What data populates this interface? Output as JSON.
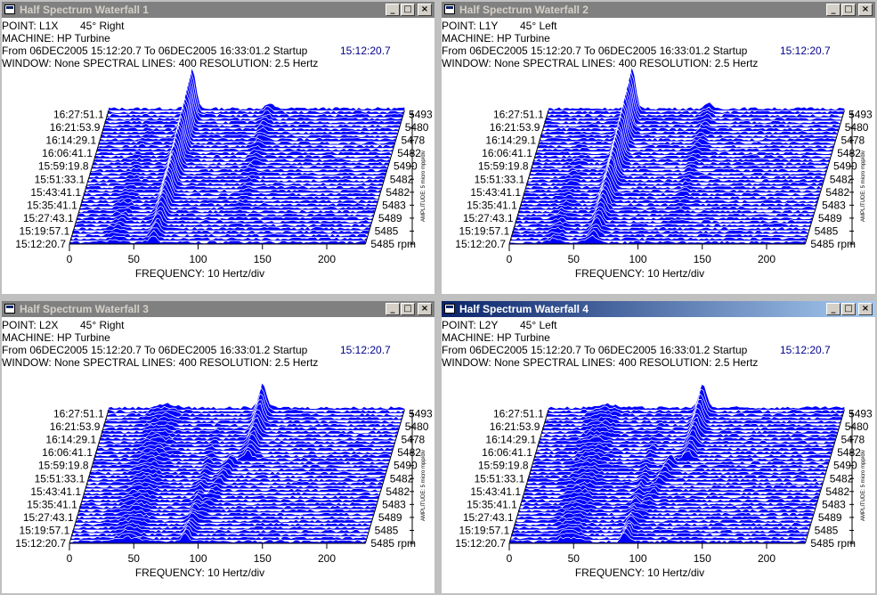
{
  "windows": [
    {
      "title": "Half Spectrum Waterfall 1",
      "active": false,
      "point": "POINT: L1X",
      "angle": "45° Right",
      "machine": "MACHINE: HP Turbine",
      "range": "From 06DEC2005 15:12:20.7 To 06DEC2005 16:33:01.2 Startup",
      "time": "15:12:20.7",
      "window_line": "WINDOW: None SPECTRAL LINES: 400 RESOLUTION: 2.5 Hertz",
      "peak_freq": 65,
      "peak_trend": "front-to-back"
    },
    {
      "title": "Half Spectrum Waterfall 2",
      "active": false,
      "point": "POINT: L1Y",
      "angle": "45° Left",
      "machine": "MACHINE: HP Turbine",
      "range": "From 06DEC2005 15:12:20.7 To 06DEC2005 16:33:01.2 Startup",
      "time": "15:12:20.7",
      "window_line": "WINDOW: None SPECTRAL LINES: 400 RESOLUTION: 2.5 Hertz",
      "peak_freq": 65,
      "peak_trend": "front-to-back"
    },
    {
      "title": "Half Spectrum Waterfall 3",
      "active": false,
      "point": "POINT: L2X",
      "angle": "45° Right",
      "machine": "MACHINE: HP Turbine",
      "range": "From 06DEC2005 15:12:20.7 To 06DEC2005 16:33:01.2 Startup",
      "time": "15:12:20.7",
      "window_line": "WINDOW: None SPECTRAL LINES: 400 RESOLUTION: 2.5 Hertz",
      "peak_freq": 90,
      "peak_trend": "back"
    },
    {
      "title": "Half Spectrum Waterfall 4",
      "active": true,
      "point": "POINT: L2Y",
      "angle": "45° Left",
      "machine": "MACHINE: HP Turbine",
      "range": "From 06DEC2005 15:12:20.7 To 06DEC2005 16:33:01.2 Startup",
      "time": "15:12:20.7",
      "window_line": "WINDOW: None SPECTRAL LINES: 400 RESOLUTION: 2.5 Hertz",
      "peak_freq": 90,
      "peak_trend": "back"
    }
  ],
  "chart_data": {
    "type": "waterfall",
    "xlabel": "FREQUENCY: 10 Hertz/div",
    "x_ticks": [
      "0",
      "50",
      "100",
      "150",
      "200"
    ],
    "xlim": [
      0,
      200
    ],
    "ylabel": "AMPLITUDE: 5 micro mpp/div",
    "time_labels": [
      "16:27:51.1",
      "16:21:53.9",
      "16:14:29.1",
      "16:06:41.1",
      "15:59:19.8",
      "15:51:33.1",
      "15:43:41.1",
      "15:35:41.1",
      "15:27:43.1",
      "15:19:57.1",
      "15:12:20.7"
    ],
    "rpm_labels": [
      "5493",
      "5480",
      "5478",
      "5482",
      "5490",
      "5482",
      "5482",
      "5483",
      "5489",
      "5485",
      "5485 rpm"
    ],
    "fill_color": "#0000ff",
    "line_color": "#ffffff"
  },
  "buttons": {
    "minimize": "_",
    "maximize": "□",
    "close": "×"
  }
}
